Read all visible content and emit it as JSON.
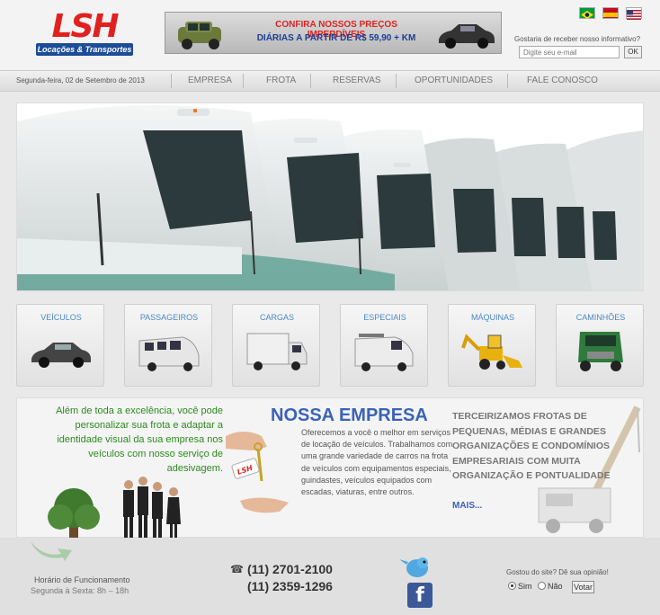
{
  "logo": {
    "text": "LSH",
    "subtitle": "Locações & Transportes"
  },
  "banner": {
    "line1": "CONFIRA NOSSOS PREÇOS IMPERDÍVEIS",
    "line2": "DIÁRIAS A PARTIR DE R$ 59,90 + KM"
  },
  "flags": [
    {
      "name": "brazil-flag",
      "color": "#009b3a"
    },
    {
      "name": "spain-flag",
      "color": "#c60b1e"
    },
    {
      "name": "usa-flag",
      "color": "#3c3b6e"
    }
  ],
  "newsletter": {
    "label": "Gostaria de receber nosso informativo?",
    "placeholder": "Digite seu e-mail",
    "button": "OK"
  },
  "nav": {
    "date": "Segunda-feira, 02 de Setembro de 2013",
    "items": [
      "EMPRESA",
      "FROTA",
      "RESERVAS",
      "OPORTUNIDADES",
      "FALE CONOSCO"
    ]
  },
  "categories": [
    "VEÍCULOS",
    "PASSAGEIROS",
    "CARGAS",
    "ESPECIAIS",
    "MÁQUINAS",
    "CAMINHÕES"
  ],
  "intro": "Além de toda a excelência, você pode personalizar sua frota e adaptar a identidade visual da sua empresa nos veículos com nosso serviço de adesivagem.",
  "company": {
    "title": "NOSSA EMPRESA",
    "text": "Oferecemos a você o melhor em serviços de locação de veículos. Trabalhamos com uma grande variedade de carros na frota de veículos com equipamentos especiais, guindastes, veículos equipados com escadas, viaturas, entre outros.",
    "key_tag": "LSH"
  },
  "outsourcing": {
    "text": "TERCEIRIZAMOS FROTAS DE PEQUENAS, MÉDIAS E GRANDES ORGANIZAÇÕES E CONDOMÍNIOS EMPRESARIAIS COM MUITA ORGANIZAÇÃO E PONTUALIDADE",
    "more": "MAIS..."
  },
  "footer": {
    "hours_label": "Horário de Funcionamento",
    "hours_value": "Segunda à Sexta: 8h – 18h",
    "phone1": "(11) 2701-2100",
    "phone2": "(11) 2359-1296",
    "poll_question": "Gostou do site? Dê sua opinião!",
    "option_yes": "Sim",
    "option_no": "Não",
    "vote": "Votar"
  },
  "colors": {
    "brand_red": "#e1211f",
    "brand_blue": "#1c4c9a",
    "accent_blue": "#3a62b8",
    "green_text": "#2c8a1f"
  }
}
